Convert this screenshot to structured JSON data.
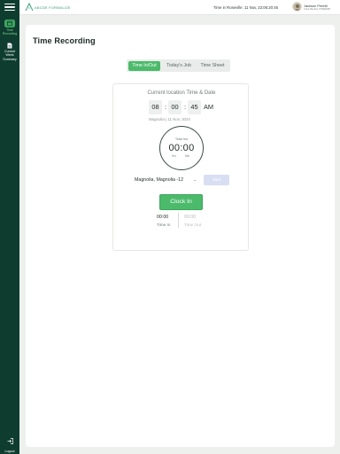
{
  "sidebar": {
    "items": [
      {
        "label": "Time Recording",
        "icon": "calendar-clock-icon",
        "active": true
      },
      {
        "label": "Current Week Summary",
        "icon": "document-icon",
        "active": false
      }
    ],
    "logout_label": "Logout"
  },
  "topbar": {
    "brand": "ABCDE FORMALIZE",
    "time_info": "Time in Roseville: 11 Nov, 22:06:20:45",
    "user_name": "Jackson Peretti",
    "user_role": "Crew Member 07/WEI008"
  },
  "page": {
    "title": "Time Recording"
  },
  "tabs": [
    {
      "label": "Time In/Out",
      "active": true
    },
    {
      "label": "Today's Job",
      "active": false
    },
    {
      "label": "Time Sheet",
      "active": false
    }
  ],
  "panel": {
    "title": "Current location Time & Date",
    "hours": "08",
    "minutes": "00",
    "seconds": "45",
    "ampm": "AM",
    "location_date": "Magnolia | 11 Nov, 2024",
    "clock_label": "Total hrs",
    "clock_time": "00:00",
    "clock_unit_hrs": "Hrs",
    "clock_unit_min": "Min",
    "job_value": "Magnolia, Magnolia -12",
    "start_label": "Start",
    "clock_in_label": "Clock In",
    "time_in_value": "00:00",
    "time_in_label": "Time In",
    "time_out_value": "00:00",
    "time_out_label": "Time Out"
  },
  "colors": {
    "sidebar_bg": "#0e3d30",
    "accent_green": "#4cba6b",
    "disabled_blue": "#d8dff3"
  }
}
